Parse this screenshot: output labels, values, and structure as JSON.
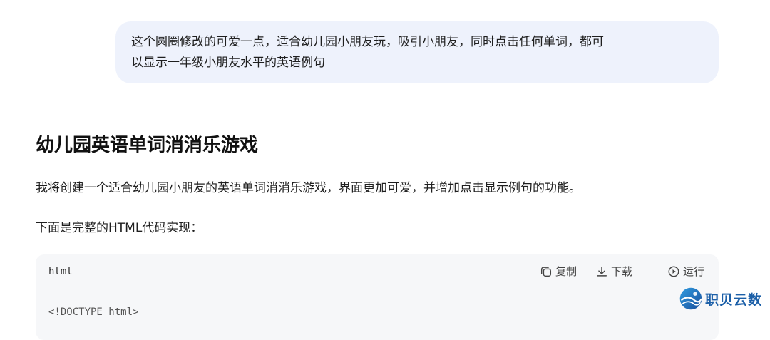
{
  "user_message": {
    "line_1": "这个圆圈修改的可爱一点，适合幼儿园小朋友玩，吸引小朋友，同时点击任何单词，都可",
    "line_2": "以显示一年级小朋友水平的英语例句"
  },
  "answer": {
    "title": "幼儿园英语单词消消乐游戏",
    "paragraph_1": "我将创建一个适合幼儿园小朋友的英语单词消消乐游戏，界面更加可爱，并增加点击显示例句的功能。",
    "paragraph_2": "下面是完整的HTML代码实现："
  },
  "code_block": {
    "language": "html",
    "copy_label": "复制",
    "download_label": "下载",
    "run_label": "运行",
    "first_line": "<!DOCTYPE html>"
  },
  "watermark": {
    "text": "职贝云数"
  },
  "icons": {
    "copy": "copy-icon",
    "download": "download-icon",
    "run": "play-icon",
    "logo": "zhibei-logo-icon"
  },
  "colors": {
    "user_bubble": "#eef2fc",
    "code_background": "#f6f7f9",
    "watermark_text": "#1b5fa8"
  }
}
